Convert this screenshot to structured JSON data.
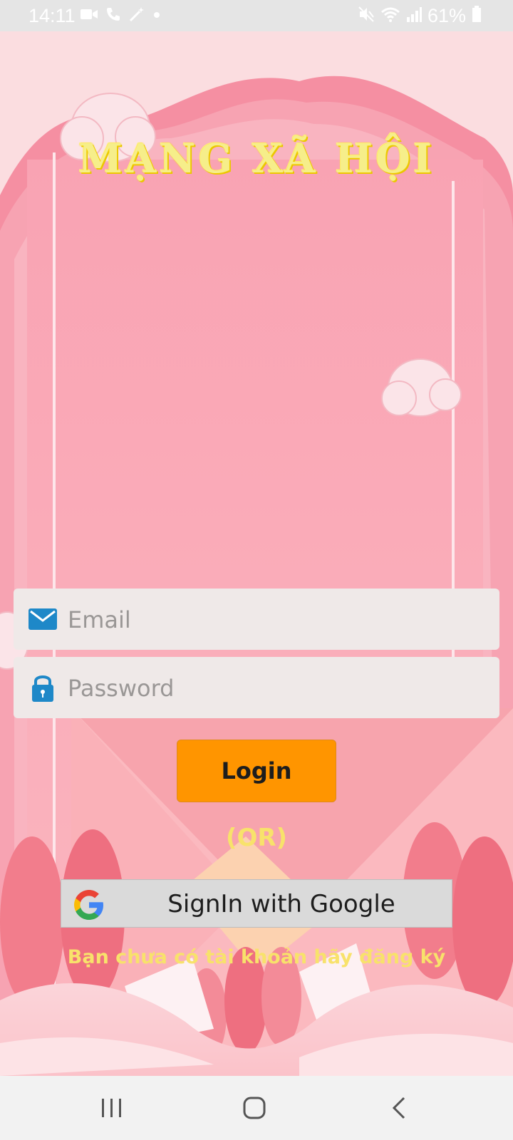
{
  "status_bar": {
    "time": "14:11",
    "battery": "61%",
    "left_icons": [
      "video-call-icon",
      "phone-icon",
      "magic-wand-icon",
      "dot-icon"
    ],
    "right_icons": [
      "mute-icon",
      "wifi-icon",
      "signal-icon",
      "battery-icon"
    ]
  },
  "app": {
    "title": "MẠNG XÃ HỘI"
  },
  "login_form": {
    "email_placeholder": "Email",
    "password_placeholder": "Password",
    "login_label": "Login",
    "or_label": "(OR)",
    "google_label": "SignIn with Google",
    "register_label": "Bạn chưa có tài khoản hãy đăng ký"
  },
  "colors": {
    "login_button": "#ff9500",
    "title_yellow": "#f6ee8a",
    "field_bg": "#efe9e8",
    "icon_blue": "#1e88c8"
  },
  "nav_bar": {
    "buttons": [
      "recent-apps-icon",
      "home-icon",
      "back-icon"
    ]
  }
}
